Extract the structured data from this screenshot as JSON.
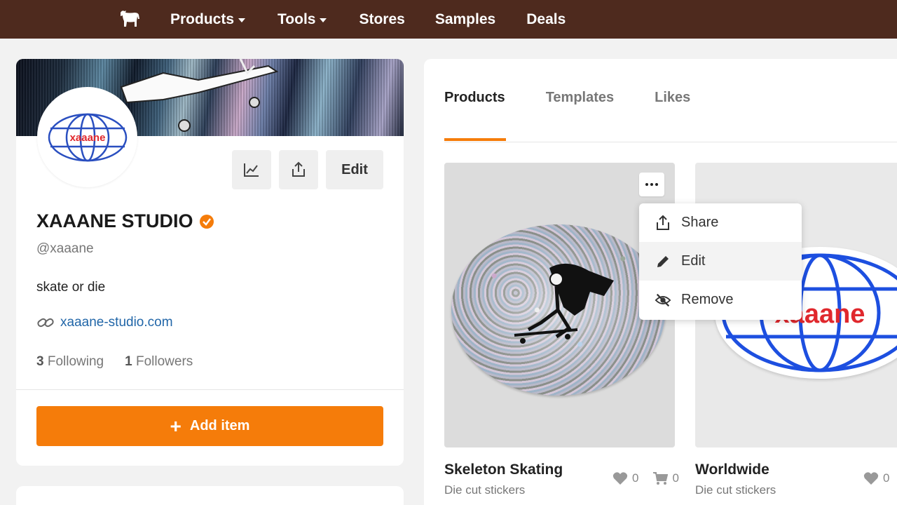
{
  "nav": {
    "logo_icon": "horse-icon",
    "items": [
      {
        "label": "Products",
        "has_caret": true
      },
      {
        "label": "Tools",
        "has_caret": true
      },
      {
        "label": "Stores",
        "has_caret": false
      },
      {
        "label": "Samples",
        "has_caret": false
      },
      {
        "label": "Deals",
        "has_caret": false
      }
    ],
    "bg_color": "#4e2a1e"
  },
  "profile": {
    "avatar_text": "xaaane",
    "edit_label": "Edit",
    "name": "XAAANE STUDIO",
    "handle": "@xaaane",
    "bio": "skate or die",
    "website": "xaaane-studio.com",
    "following_count": "3",
    "following_label": "Following",
    "followers_count": "1",
    "followers_label": "Followers",
    "add_item_label": "Add item",
    "accent_color": "#f57c0a"
  },
  "tabs": [
    {
      "label": "Products",
      "active": true
    },
    {
      "label": "Templates",
      "active": false
    },
    {
      "label": "Likes",
      "active": false
    }
  ],
  "context_menu": {
    "items": [
      {
        "label": "Share",
        "icon": "share-icon"
      },
      {
        "label": "Edit",
        "icon": "pencil-icon"
      },
      {
        "label": "Remove",
        "icon": "eye-slash-icon"
      }
    ]
  },
  "products": [
    {
      "title": "Skeleton Skating",
      "subtitle": "Die cut stickers",
      "likes": "0",
      "carts": "0"
    },
    {
      "title": "Worldwide",
      "subtitle": "Die cut stickers",
      "likes": "0",
      "sticker_text": "xaaane"
    }
  ]
}
